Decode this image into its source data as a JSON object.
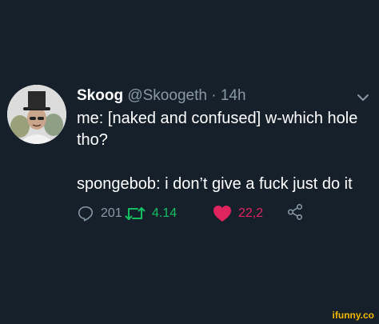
{
  "tweet": {
    "display_name": "Skoog",
    "handle": "@Skoogeth",
    "separator": "·",
    "time": "14h",
    "text_line1": "me: [naked and confused] w-which hole tho?",
    "text_line2": "spongebob: i don’t give a fuck just do it"
  },
  "actions": {
    "replies": "201",
    "retweets": "4.14",
    "likes": "22,2"
  },
  "watermark": "ifunny.co",
  "colors": {
    "background": "#15202b",
    "muted": "#8899a6",
    "retweet": "#17bf63",
    "like": "#e0245e",
    "watermark": "#f5b800"
  },
  "icons": [
    "avatar-image",
    "chevron-down-icon",
    "reply-icon",
    "retweet-icon",
    "heart-icon",
    "share-icon"
  ]
}
